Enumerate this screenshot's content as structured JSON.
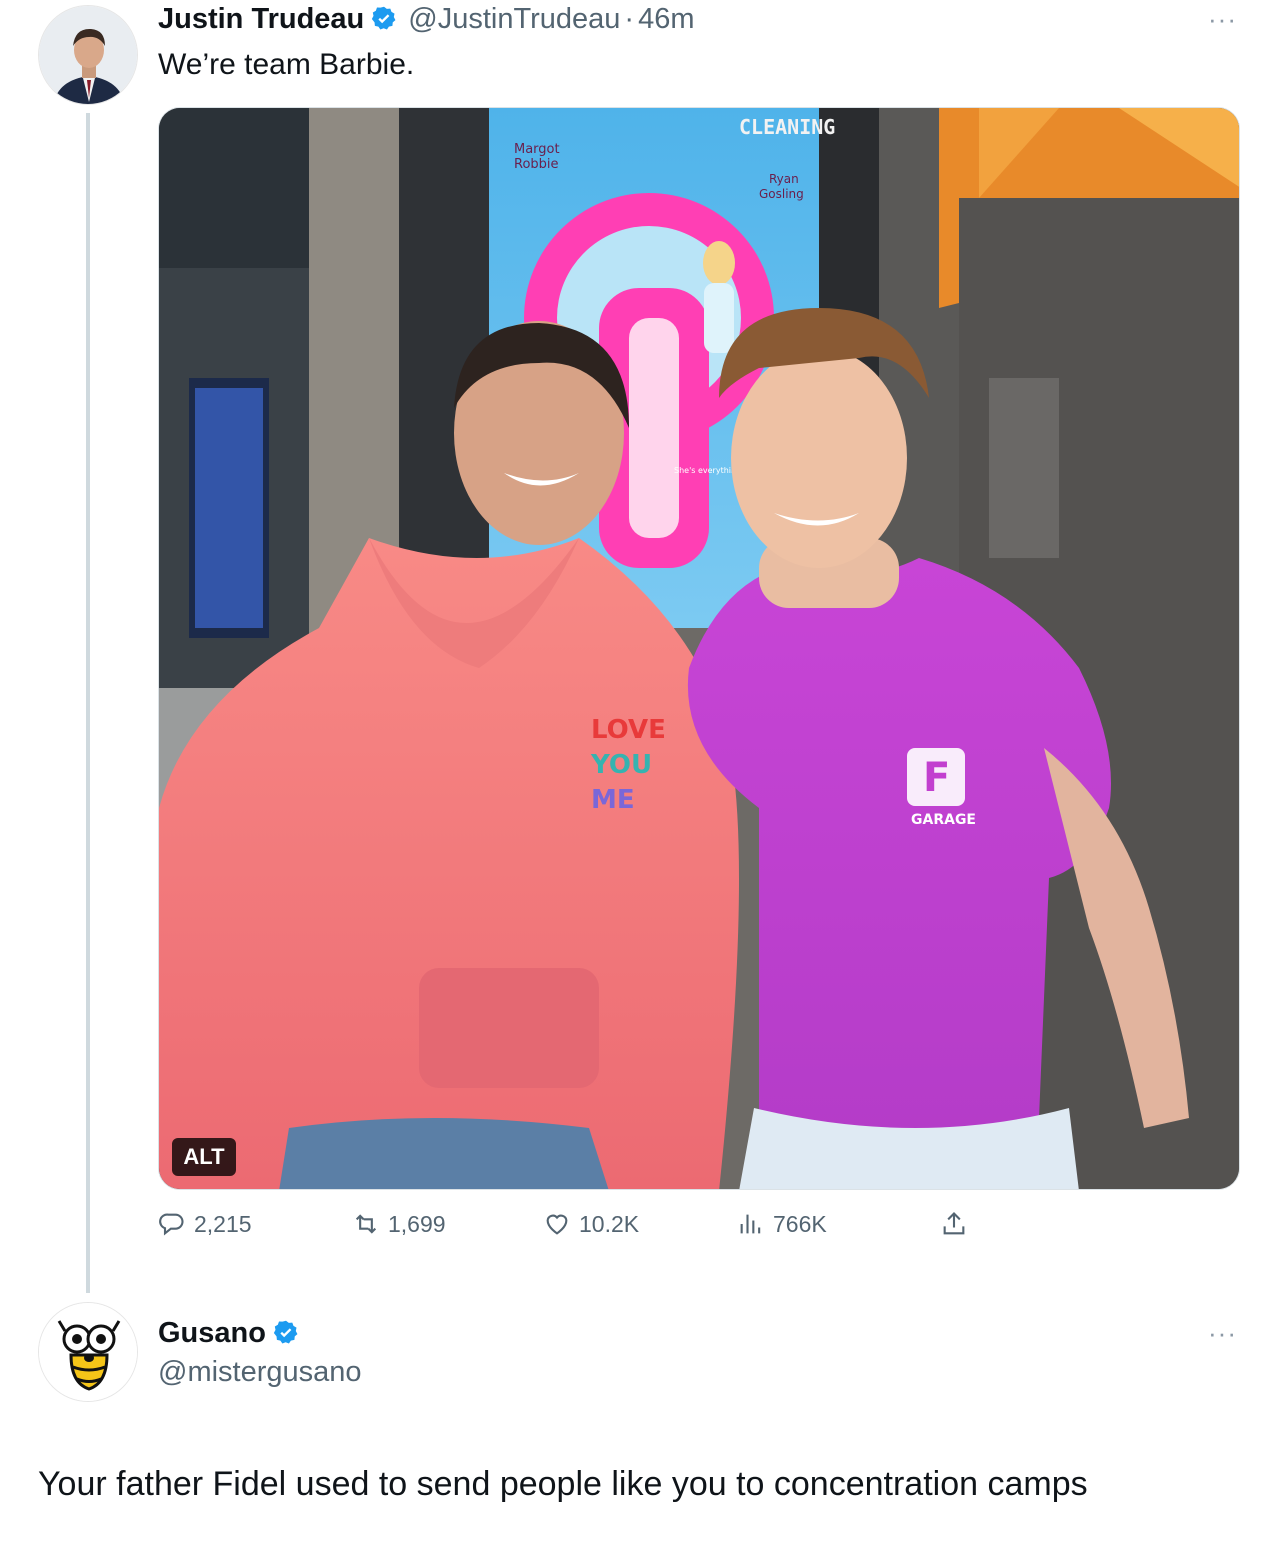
{
  "tweet": {
    "author_name": "Justin Trudeau",
    "handle": "@JustinTrudeau",
    "separator": "·",
    "time": "46m",
    "text": "We’re team Barbie.",
    "more_label": "···",
    "media": {
      "alt_badge": "ALT",
      "poster": {
        "top_left": "Margot\nRobbie",
        "top_right": "Ryan\nGosling",
        "cleaning": "CLEANING",
        "tagline": "She's everything\nHe's just Ken"
      },
      "hoodie_print": "LOVE YOU ME",
      "shirt_logo_letter": "F",
      "shirt_logo_text": "GARAGE"
    },
    "stats": {
      "replies": "2,215",
      "retweets": "1,699",
      "likes": "10.2K",
      "views": "766K"
    }
  },
  "reply": {
    "author_name": "Gusano",
    "handle": "@mistergusano",
    "more_label": "···",
    "text": "Your father Fidel used to send people like you to concentration camps"
  },
  "colors": {
    "verified_blue": "#1d9bf0",
    "muted_text": "#536471",
    "thread_line": "#cfd9de",
    "hoodie": "#f27a7f",
    "tshirt": "#cc3fd0",
    "barbie_pink": "#ff3fb4"
  },
  "icons": [
    "verified-badge-icon",
    "reply-icon",
    "retweet-icon",
    "like-icon",
    "views-icon",
    "share-icon",
    "more-icon"
  ]
}
